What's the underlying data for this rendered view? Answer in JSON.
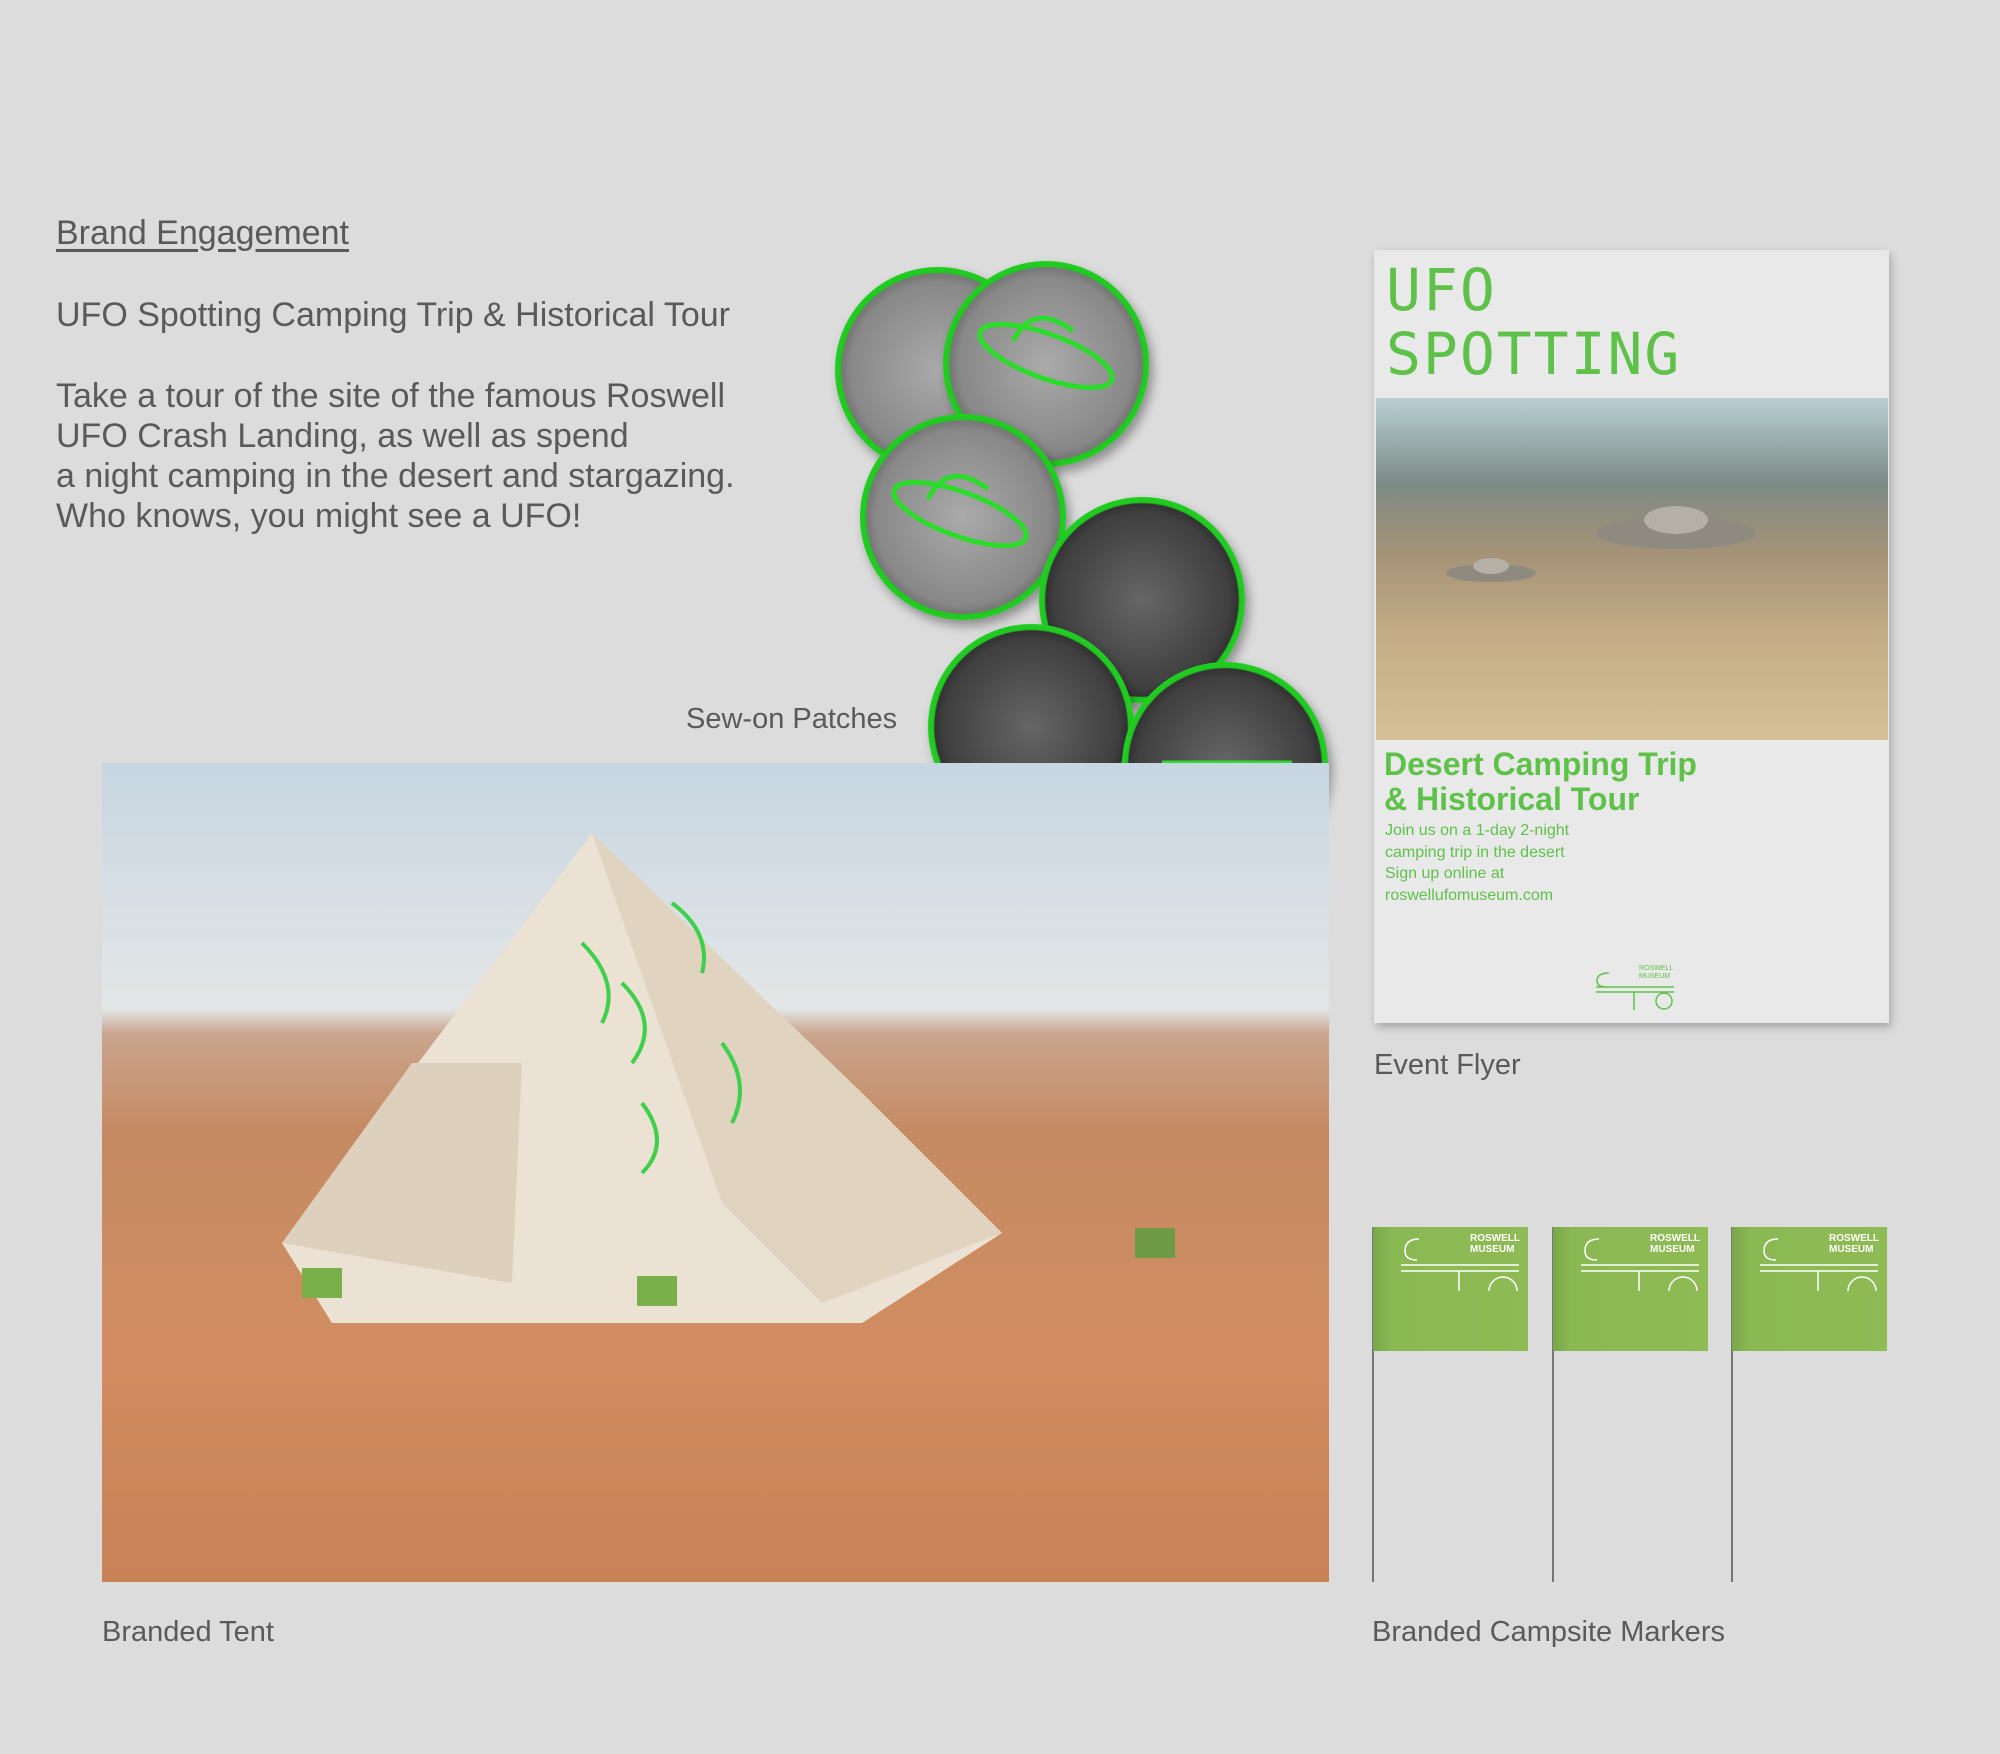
{
  "heading": "Brand Engagement",
  "subtitle": "UFO Spotting Camping Trip & Historical Tour",
  "paragraph": [
    "Take a tour of the site of the famous Roswell",
    "UFO Crash Landing, as well as spend",
    "a night camping in the desert and stargazing.",
    "Who knows, you might see a UFO!"
  ],
  "captions": {
    "patches": "Sew-on Patches",
    "tent": "Branded Tent",
    "flyer": "Event Flyer",
    "markers": "Branded Campsite Markers"
  },
  "flyer": {
    "title": [
      "UFO",
      "SPOTTING"
    ],
    "headline": [
      "Desert Camping Trip",
      "& Historical Tour"
    ],
    "body": [
      "Join us on a 1-day 2-night",
      "camping trip in the desert",
      "Sign up online at",
      "roswellufomuseum.com"
    ],
    "logo_text": [
      "ROSWELL",
      "MUSEUM"
    ]
  },
  "marker": {
    "logo_text": [
      "ROSWELL",
      "MUSEUM"
    ]
  },
  "colors": {
    "background": "#dcdcdc",
    "brand_green": "#5ec24a",
    "patch_green": "#2bdc2b",
    "flag_green": "#8fbb55"
  }
}
